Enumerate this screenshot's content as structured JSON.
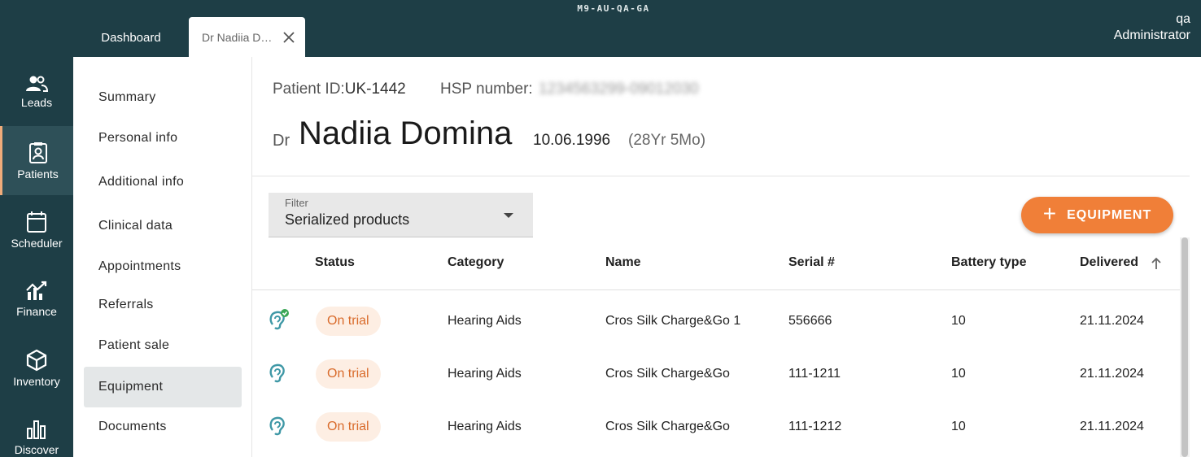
{
  "app": {
    "env_label": "M9-AU-QA-GA",
    "user": {
      "name": "qa",
      "role": "Administrator"
    }
  },
  "tabs": [
    {
      "label": "Dashboard"
    },
    {
      "label": "Dr Nadiia Domina"
    }
  ],
  "leftnav": [
    {
      "label": "Leads",
      "icon": "users-icon"
    },
    {
      "label": "Patients",
      "icon": "patient-badge-icon"
    },
    {
      "label": "Scheduler",
      "icon": "calendar-icon"
    },
    {
      "label": "Finance",
      "icon": "finance-chart-icon"
    },
    {
      "label": "Inventory",
      "icon": "box-icon"
    },
    {
      "label": "Discover",
      "icon": "bar-chart-icon"
    }
  ],
  "submenu": [
    {
      "label": "Summary"
    },
    {
      "label": "Personal info"
    },
    {
      "label": "Additional info"
    },
    {
      "label": "Clinical data"
    },
    {
      "label": "Appointments"
    },
    {
      "label": "Referrals"
    },
    {
      "label": "Patient sale"
    },
    {
      "label": "Equipment"
    },
    {
      "label": "Documents"
    }
  ],
  "patient": {
    "id_label": "Patient ID:",
    "id_value": "UK-1442",
    "hsp_label": "HSP number:",
    "hsp_value": "1234563299-09012030",
    "title": "Dr",
    "name": "Nadiia Domina",
    "dob": "10.06.1996",
    "age": "(28Yr 5Mo)"
  },
  "filter": {
    "label": "Filter",
    "value": "Serialized products"
  },
  "add_button": {
    "label": "EQUIPMENT"
  },
  "table": {
    "headers": {
      "status": "Status",
      "category": "Category",
      "name": "Name",
      "serial": "Serial #",
      "battery": "Battery type",
      "delivered": "Delivered"
    },
    "rows": [
      {
        "status": "On trial",
        "category": "Hearing Aids",
        "name": "Cros Silk Charge&Go 1",
        "serial": "556666",
        "battery": "10",
        "delivered": "21.11.2024"
      },
      {
        "status": "On trial",
        "category": "Hearing Aids",
        "name": "Cros Silk Charge&Go",
        "serial": "111-1211",
        "battery": "10",
        "delivered": "21.11.2024"
      },
      {
        "status": "On trial",
        "category": "Hearing Aids",
        "name": "Cros Silk Charge&Go",
        "serial": "111-1212",
        "battery": "10",
        "delivered": "21.11.2024"
      }
    ]
  },
  "colors": {
    "sidebar_bg": "#1e3e46",
    "accent": "#f07f38",
    "status_text": "#d96b2b",
    "status_bg": "#fdeee3",
    "active_check": "#3aa655"
  }
}
